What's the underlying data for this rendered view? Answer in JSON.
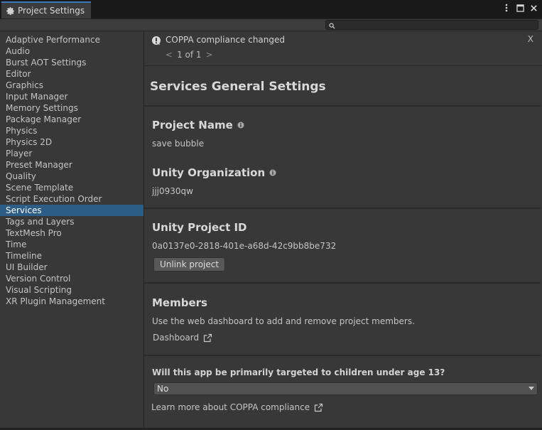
{
  "window": {
    "tab_title": "Project Settings",
    "controls": [
      "more-icon",
      "maximize-icon",
      "close-icon"
    ]
  },
  "search": {
    "placeholder": ""
  },
  "sidebar": {
    "items": [
      {
        "label": "Adaptive Performance"
      },
      {
        "label": "Audio"
      },
      {
        "label": "Burst AOT Settings"
      },
      {
        "label": "Editor"
      },
      {
        "label": "Graphics"
      },
      {
        "label": "Input Manager"
      },
      {
        "label": "Memory Settings"
      },
      {
        "label": "Package Manager"
      },
      {
        "label": "Physics"
      },
      {
        "label": "Physics 2D"
      },
      {
        "label": "Player"
      },
      {
        "label": "Preset Manager"
      },
      {
        "label": "Quality"
      },
      {
        "label": "Scene Template"
      },
      {
        "label": "Script Execution Order"
      },
      {
        "label": "Services",
        "active": true
      },
      {
        "label": "Tags and Layers"
      },
      {
        "label": "TextMesh Pro"
      },
      {
        "label": "Time"
      },
      {
        "label": "Timeline"
      },
      {
        "label": "UI Builder"
      },
      {
        "label": "Version Control"
      },
      {
        "label": "Visual Scripting"
      },
      {
        "label": "XR Plugin Management"
      }
    ]
  },
  "notification": {
    "text": "COPPA compliance changed",
    "close": "X",
    "prev": "<",
    "page": "1 of 1",
    "next": ">"
  },
  "main": {
    "title": "Services General Settings",
    "project_name_label": "Project Name",
    "project_name_value": "save bubble",
    "org_label": "Unity Organization",
    "org_value": "jjj0930qw",
    "project_id_label": "Unity Project ID",
    "project_id_value": "0a0137e0-2818-401e-a68d-42c9bb8be732",
    "unlink_button": "Unlink project",
    "members_label": "Members",
    "members_desc": "Use the web dashboard to add and remove project members.",
    "dashboard_link": "Dashboard",
    "coppa_question": "Will this app be primarily targeted to children under age 13?",
    "coppa_value": "No",
    "coppa_learn_more": "Learn more about COPPA compliance"
  },
  "colors": {
    "accent": "#2c5d87",
    "tab_highlight": "#3a79bb",
    "panel": "#383838"
  }
}
